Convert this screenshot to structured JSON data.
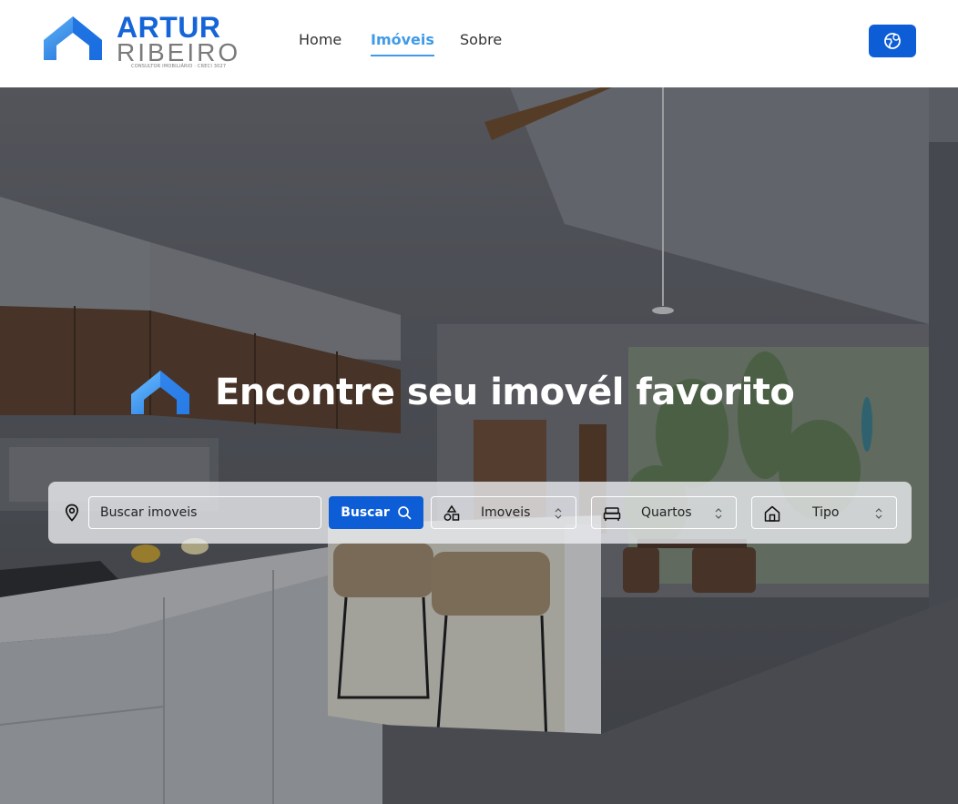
{
  "header": {
    "logo": {
      "name_line1": "ARTUR",
      "name_line2": "RIBEIRO",
      "tagline": "CONSULTOR IMOBILIÁRIO · CRECI 3027",
      "icon": "house-roof-logo"
    },
    "nav": [
      {
        "label": "Home",
        "active": false
      },
      {
        "label": "Imóveis",
        "active": true
      },
      {
        "label": "Sobre",
        "active": false
      }
    ],
    "language_button": {
      "icon": "globe-icon"
    }
  },
  "hero": {
    "title": "Encontre seu imovél favorito",
    "icon": "house-roof-logo"
  },
  "search": {
    "location_icon": "map-pin-icon",
    "placeholder": "Buscar imoveis",
    "button_label": "Buscar",
    "button_icon": "search-icon",
    "filters": [
      {
        "label": "Imoveis",
        "icon": "shapes-icon"
      },
      {
        "label": "Quartos",
        "icon": "bed-icon"
      },
      {
        "label": "Tipo",
        "icon": "home-icon"
      }
    ]
  },
  "colors": {
    "primary": "#0d5dd6",
    "nav_active": "#3f9be7",
    "logo_blue": "#1565d8",
    "logo_gray": "#7a7a7a"
  }
}
